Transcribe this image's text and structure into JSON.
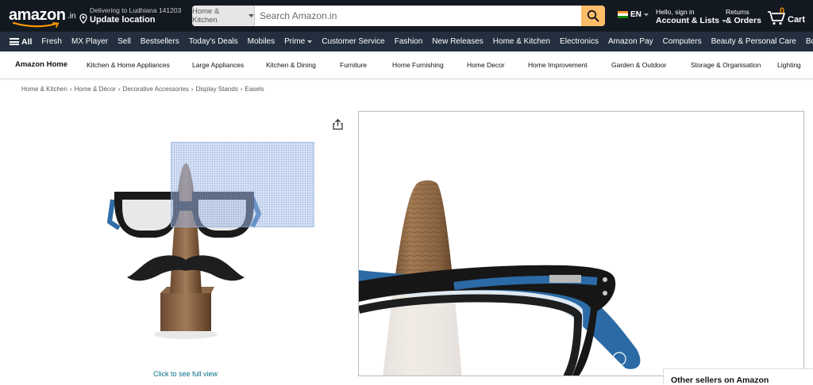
{
  "header": {
    "logo_text": "amazon",
    "logo_suffix": ".in",
    "deliver_line1": "Delivering to Ludhiana 141203",
    "deliver_line2": "Update location",
    "search_category": "Home & Kitchen",
    "search_placeholder": "Search Amazon.in",
    "language": "EN",
    "account_line1": "Hello, sign in",
    "account_line2": "Account & Lists",
    "returns_line1": "Returns",
    "returns_line2": "& Orders",
    "cart_count": "0",
    "cart_label": "Cart"
  },
  "main_nav": {
    "all_label": "All",
    "items": [
      "Fresh",
      "MX Player",
      "Sell",
      "Bestsellers",
      "Today's Deals",
      "Mobiles",
      "Prime",
      "Customer Service",
      "Fashion",
      "New Releases",
      "Home & Kitchen",
      "Electronics",
      "Amazon Pay",
      "Computers",
      "Beauty & Personal Care",
      "Books"
    ]
  },
  "store_nav": {
    "home": "Amazon Home",
    "items": [
      "Kitchen & Home Appliances",
      "Large Appliances",
      "Kitchen & Dining",
      "Furniture",
      "Home Furnishing",
      "Home Decor",
      "Home Improvement",
      "Garden & Outdoor",
      "Storage & Organisation",
      "Lighting"
    ]
  },
  "breadcrumb": [
    "Home & Kitchen",
    "Home & Décor",
    "Decorative Accessories",
    "Display Stands",
    "Easels"
  ],
  "product": {
    "full_view_link": "Click to see full view"
  },
  "sidebar": {
    "other_sellers": "Other sellers on Amazon"
  },
  "colors": {
    "nav_dark": "#131921",
    "nav_main": "#232f3e",
    "search_button": "#febd69",
    "link": "#007185",
    "cart_count": "#f08804"
  }
}
